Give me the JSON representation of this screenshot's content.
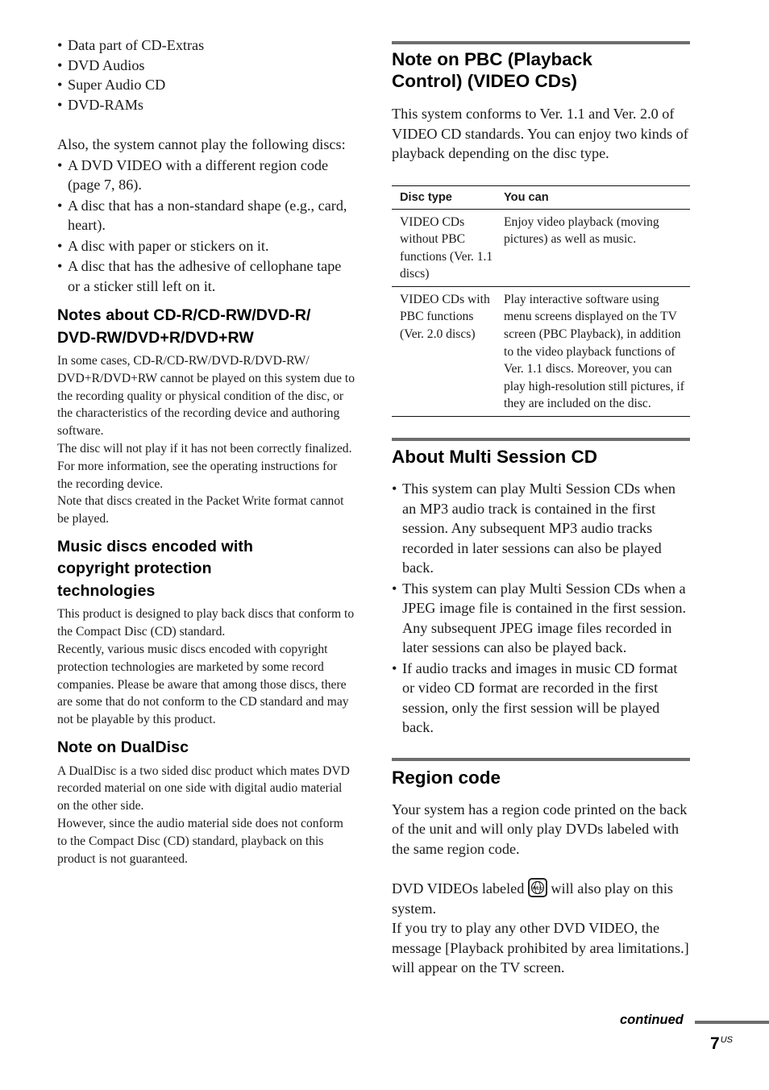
{
  "left": {
    "top_bullets": [
      "Data part of CD-Extras",
      "DVD Audios",
      "Super Audio CD",
      "DVD-RAMs"
    ],
    "also_intro": "Also, the system cannot play the following discs:",
    "cannot_play": [
      "A DVD VIDEO with a different region code (page 7, 86).",
      "A disc that has a non-standard shape (e.g., card, heart).",
      "A disc with paper or stickers on it.",
      "A disc that has the adhesive of cellophane tape or a sticker still left on it."
    ],
    "sections": [
      {
        "heading": "Notes about CD-R/CD-RW/DVD-R/ DVD-RW/DVD+R/DVD+RW",
        "paragraphs": [
          "In some cases, CD-R/CD-RW/DVD-R/DVD-RW/ DVD+R/DVD+RW cannot be played on this system due to the recording quality or physical condition of the disc, or the characteristics of the recording device and authoring software.",
          "The disc will not play if it has not been correctly finalized. For more information, see the operating instructions for the recording device.",
          "Note that discs created in the Packet Write format cannot be played."
        ]
      },
      {
        "heading": "Music discs encoded with copyright protection technologies",
        "paragraphs": [
          "This product is designed to play back discs that conform to the Compact Disc (CD) standard.",
          "Recently, various music discs encoded with copyright protection technologies are marketed by some record companies. Please be aware that among those discs, there are some that do not conform to the CD standard and may not be playable by this product."
        ]
      },
      {
        "heading": "Note on DualDisc",
        "paragraphs": [
          "A DualDisc is a two sided disc product which mates DVD recorded material on one side with digital audio material on the other side.",
          "However, since the audio material side does not conform to the Compact Disc (CD) standard, playback on this product is not guaranteed."
        ]
      }
    ]
  },
  "right": {
    "pbc": {
      "heading": "Note on PBC (Playback Control) (VIDEO CDs)",
      "intro": "This system conforms to Ver. 1.1 and Ver. 2.0 of VIDEO CD standards. You can enjoy two kinds of playback depending on the disc type.",
      "table": {
        "headers": [
          "Disc type",
          "You can"
        ],
        "rows": [
          [
            "VIDEO CDs without PBC functions (Ver. 1.1 discs)",
            "Enjoy video playback (moving pictures) as well as music."
          ],
          [
            "VIDEO CDs with PBC functions (Ver. 2.0 discs)",
            "Play interactive software using menu screens displayed on the TV screen (PBC Playback), in addition to the video playback functions of Ver. 1.1 discs. Moreover, you can play high-resolution still pictures, if they are included on the disc."
          ]
        ]
      }
    },
    "multisession": {
      "heading": "About Multi Session CD",
      "bullets": [
        "This system can play Multi Session CDs when an MP3 audio track is contained in the first session. Any subsequent MP3 audio tracks recorded in later sessions can also be played back.",
        "This system can play Multi Session CDs when a JPEG image file is contained in the first session. Any subsequent JPEG image files recorded in later sessions can also be played back.",
        "If audio tracks and images in music CD format or video CD format are recorded in the first session, only the first session will be played back."
      ]
    },
    "region": {
      "heading": "Region code",
      "para1": "Your system has a region code printed on the back of the unit and will only play DVDs labeled with the same region code.",
      "para2_before_icon": "DVD VIDEOs labeled",
      "icon_label": "ALL",
      "para2_after_icon": "will also play on this system.",
      "para3": "If you try to play any other DVD VIDEO, the message [Playback prohibited by area limitations.] will appear on the TV screen."
    }
  },
  "footer": {
    "continued": "continued",
    "page_number": "7",
    "page_suffix": "US"
  }
}
